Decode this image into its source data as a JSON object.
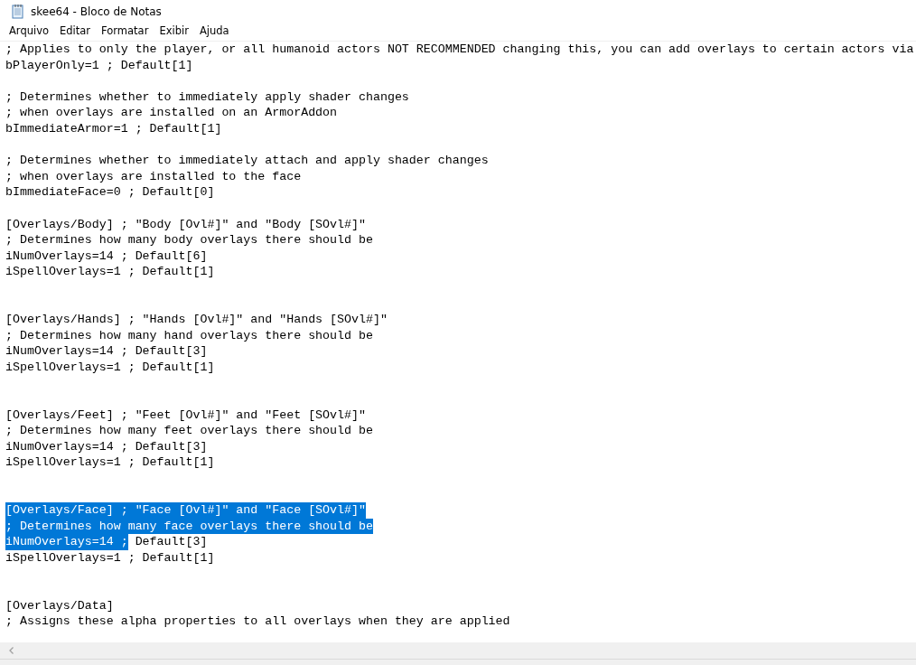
{
  "window": {
    "title": "skee64 - Bloco de Notas"
  },
  "menu": [
    "Arquivo",
    "Editar",
    "Formatar",
    "Exibir",
    "Ajuda"
  ],
  "editor": {
    "lines": [
      {
        "kind": "text",
        "segments": [
          {
            "text": "; Applies to only the player, or all humanoid actors NOT RECOMMENDED changing this, you can add overlays to certain actors via",
            "selected": false
          }
        ]
      },
      {
        "kind": "text",
        "segments": [
          {
            "text": "bPlayerOnly=1 ; Default[1]",
            "selected": false
          }
        ]
      },
      {
        "kind": "blank"
      },
      {
        "kind": "text",
        "segments": [
          {
            "text": "; Determines whether to immediately apply shader changes",
            "selected": false
          }
        ]
      },
      {
        "kind": "text",
        "segments": [
          {
            "text": "; when overlays are installed on an ArmorAddon",
            "selected": false
          }
        ]
      },
      {
        "kind": "text",
        "segments": [
          {
            "text": "bImmediateArmor=1 ; Default[1]",
            "selected": false
          }
        ]
      },
      {
        "kind": "blank"
      },
      {
        "kind": "text",
        "segments": [
          {
            "text": "; Determines whether to immediately attach and apply shader changes",
            "selected": false
          }
        ]
      },
      {
        "kind": "text",
        "segments": [
          {
            "text": "; when overlays are installed to the face",
            "selected": false
          }
        ]
      },
      {
        "kind": "text",
        "segments": [
          {
            "text": "bImmediateFace=0 ; Default[0]",
            "selected": false
          }
        ]
      },
      {
        "kind": "blank"
      },
      {
        "kind": "text",
        "segments": [
          {
            "text": "[Overlays/Body] ; \"Body [Ovl#]\" and \"Body [SOvl#]\"",
            "selected": false
          }
        ]
      },
      {
        "kind": "text",
        "segments": [
          {
            "text": "; Determines how many body overlays there should be",
            "selected": false
          }
        ]
      },
      {
        "kind": "text",
        "segments": [
          {
            "text": "iNumOverlays=14 ; Default[6]",
            "selected": false
          }
        ]
      },
      {
        "kind": "text",
        "segments": [
          {
            "text": "iSpellOverlays=1 ; Default[1]",
            "selected": false
          }
        ]
      },
      {
        "kind": "blank"
      },
      {
        "kind": "blank"
      },
      {
        "kind": "text",
        "segments": [
          {
            "text": "[Overlays/Hands] ; \"Hands [Ovl#]\" and \"Hands [SOvl#]\"",
            "selected": false
          }
        ]
      },
      {
        "kind": "text",
        "segments": [
          {
            "text": "; Determines how many hand overlays there should be",
            "selected": false
          }
        ]
      },
      {
        "kind": "text",
        "segments": [
          {
            "text": "iNumOverlays=14 ; Default[3]",
            "selected": false
          }
        ]
      },
      {
        "kind": "text",
        "segments": [
          {
            "text": "iSpellOverlays=1 ; Default[1]",
            "selected": false
          }
        ]
      },
      {
        "kind": "blank"
      },
      {
        "kind": "blank"
      },
      {
        "kind": "text",
        "segments": [
          {
            "text": "[Overlays/Feet] ; \"Feet [Ovl#]\" and \"Feet [SOvl#]\"",
            "selected": false
          }
        ]
      },
      {
        "kind": "text",
        "segments": [
          {
            "text": "; Determines how many feet overlays there should be",
            "selected": false
          }
        ]
      },
      {
        "kind": "text",
        "segments": [
          {
            "text": "iNumOverlays=14 ; Default[3]",
            "selected": false
          }
        ]
      },
      {
        "kind": "text",
        "segments": [
          {
            "text": "iSpellOverlays=1 ; Default[1]",
            "selected": false
          }
        ]
      },
      {
        "kind": "blank"
      },
      {
        "kind": "blank"
      },
      {
        "kind": "text",
        "segments": [
          {
            "text": "[Overlays/Face] ; \"Face [Ovl#]\" and \"Face [SOvl#]\"",
            "selected": true
          }
        ]
      },
      {
        "kind": "text",
        "segments": [
          {
            "text": "; Determines how many face overlays there should be",
            "selected": true
          }
        ]
      },
      {
        "kind": "text",
        "segments": [
          {
            "text": "iNumOverlays=14 ;",
            "selected": true
          },
          {
            "text": " Default[3]",
            "selected": false
          }
        ]
      },
      {
        "kind": "text",
        "segments": [
          {
            "text": "iSpellOverlays=1 ; Default[1]",
            "selected": false
          }
        ]
      },
      {
        "kind": "blank"
      },
      {
        "kind": "blank"
      },
      {
        "kind": "text",
        "segments": [
          {
            "text": "[Overlays/Data]",
            "selected": false
          }
        ]
      },
      {
        "kind": "text",
        "segments": [
          {
            "text": "; Assigns these alpha properties to all overlays when they are applied",
            "selected": false
          }
        ]
      }
    ]
  }
}
